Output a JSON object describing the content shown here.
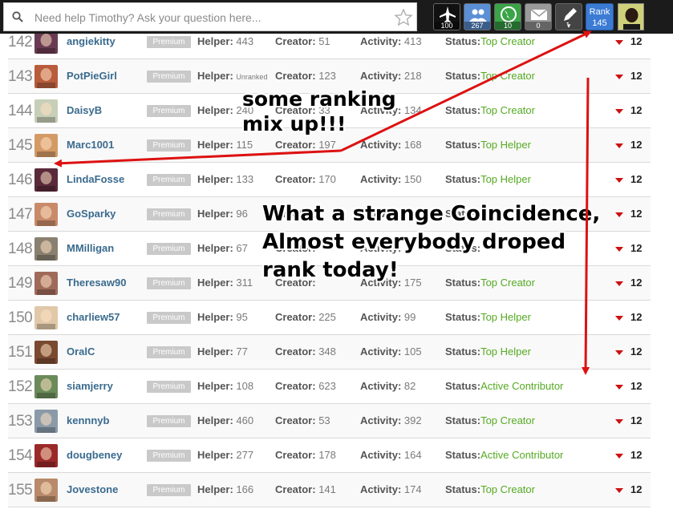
{
  "search": {
    "placeholder": "Need help Timothy? Ask your question here..."
  },
  "toolbar": {
    "buttons": [
      {
        "icon": "airplane-icon",
        "count": "100",
        "color": "#111111"
      },
      {
        "icon": "people-icon",
        "count": "267",
        "color": "#5b8fd6"
      },
      {
        "icon": "globe-icon",
        "count": "10",
        "color": "#3aa447"
      },
      {
        "icon": "mail-icon",
        "count": "0",
        "color": "#9a9a9a"
      },
      {
        "icon": "pencil-icon",
        "count": "",
        "color": "#444444"
      }
    ],
    "rank_label": "Rank",
    "rank_value": "145"
  },
  "labels": {
    "helper": "Helper:",
    "creator": "Creator:",
    "activity": "Activity:",
    "status": "Status:",
    "badge": "Premium"
  },
  "rows": [
    {
      "rank": "142",
      "name": "angiekitty",
      "helper": "443",
      "creator": "51",
      "activity": "413",
      "status": "Top Creator",
      "score": "12",
      "pic": "#6a3a52"
    },
    {
      "rank": "143",
      "name": "PotPieGirl",
      "helper": "Unranked",
      "creator": "123",
      "activity": "218",
      "status": "Top Creator",
      "score": "12",
      "pic": "#b85c3c"
    },
    {
      "rank": "144",
      "name": "DaisyB",
      "helper": "240",
      "creator": "33",
      "activity": "134",
      "status": "Top Creator",
      "score": "12",
      "pic": "#c8cfb8"
    },
    {
      "rank": "145",
      "name": "Marc1001",
      "helper": "115",
      "creator": "197",
      "activity": "168",
      "status": "Top Helper",
      "score": "12",
      "pic": "#d49a66"
    },
    {
      "rank": "146",
      "name": "LindaFosse",
      "helper": "133",
      "creator": "170",
      "activity": "150",
      "status": "Top Helper",
      "score": "12",
      "pic": "#5a2a3a"
    },
    {
      "rank": "147",
      "name": "GoSparky",
      "helper": "96",
      "creator": "",
      "activity": "",
      "status": "",
      "score": "12",
      "pic": "#c98a6a"
    },
    {
      "rank": "148",
      "name": "MMilligan",
      "helper": "67",
      "creator": "",
      "activity": "",
      "status": "",
      "score": "12",
      "pic": "#8a8070"
    },
    {
      "rank": "149",
      "name": "Theresaw90",
      "helper": "311",
      "creator": "",
      "activity": "175",
      "status": "Top Creator",
      "score": "12",
      "pic": "#a06a5a"
    },
    {
      "rank": "150",
      "name": "charliew57",
      "helper": "95",
      "creator": "225",
      "activity": "99",
      "status": "Top Helper",
      "score": "12",
      "pic": "#e0c8a8"
    },
    {
      "rank": "151",
      "name": "OralC",
      "helper": "77",
      "creator": "348",
      "activity": "105",
      "status": "Top Helper",
      "score": "12",
      "pic": "#7a4a30"
    },
    {
      "rank": "152",
      "name": "siamjerry",
      "helper": "108",
      "creator": "623",
      "activity": "82",
      "status": "Active Contributor",
      "score": "12",
      "pic": "#6a8a5a"
    },
    {
      "rank": "153",
      "name": "kennnyb",
      "helper": "460",
      "creator": "53",
      "activity": "392",
      "status": "Top Creator",
      "score": "12",
      "pic": "#8a9aa8"
    },
    {
      "rank": "154",
      "name": "dougbeney",
      "helper": "277",
      "creator": "178",
      "activity": "164",
      "status": "Active Contributor",
      "score": "12",
      "pic": "#9a2a2a"
    },
    {
      "rank": "155",
      "name": "Jovestone",
      "helper": "166",
      "creator": "141",
      "activity": "174",
      "status": "Top Creator",
      "score": "12",
      "pic": "#b88a6a"
    }
  ],
  "annotations": {
    "mixup": "some ranking\nmix up!!!",
    "coincidence": "What a strange Coincidence,\nAlmost everybody droped\nrank today!"
  },
  "colors": {
    "username": "#3a6b8e",
    "status": "#55aa22",
    "arrow": "#dd1111",
    "rank_button": "#3b7bd4"
  }
}
